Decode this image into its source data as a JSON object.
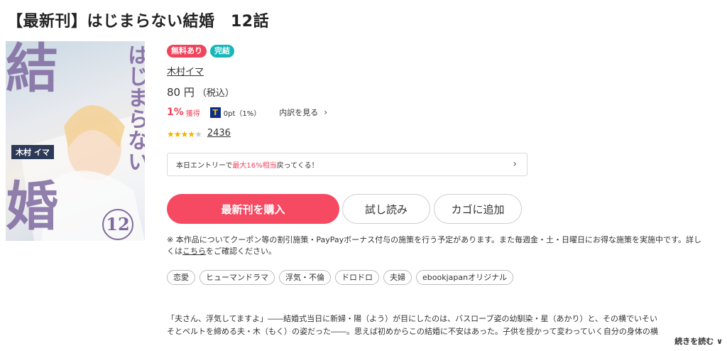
{
  "title": "【最新刊】はじまらない結婚　12話",
  "cover": {
    "big_top": "結",
    "big_bottom": "婚",
    "vertical": "はじまらない",
    "author_band": "木村 イマ",
    "volume": "12"
  },
  "badges": {
    "free": "無料あり",
    "complete": "完結"
  },
  "author": "木村イマ",
  "price": {
    "amount": "80 円",
    "tax": "（税込）"
  },
  "points": {
    "rate": "1%",
    "rate_label": "獲得",
    "t_icon": "T",
    "t_value": "0pt（1%）",
    "breakdown": "内訳を見る",
    "chevron": "›"
  },
  "rating": {
    "stars": 4,
    "count": "2436"
  },
  "entry": {
    "prefix": "本日エントリーで",
    "highlight": "最大16%相当",
    "suffix": "戻ってくる！",
    "arrow": "›"
  },
  "buttons": {
    "buy": "最新刊を購入",
    "trial": "試し読み",
    "cart": "カゴに追加"
  },
  "notice": {
    "line1": "※ 本作品についてクーポン等の割引施策・PayPayボーナス付与の施策を行う予定があります。また毎週金・土・日曜日にお得な施策を実施中です。詳し",
    "line2_prefix": "くは",
    "line2_link": "こちら",
    "line2_suffix": "をご確認ください。"
  },
  "tags": [
    "恋愛",
    "ヒューマンドラマ",
    "浮気・不倫",
    "ドロドロ",
    "夫婦",
    "ebookjapanオリジナル"
  ],
  "description": {
    "line1": "「夫さん、浮気してますよ」――結婚式当日に新婦・陽（よう）が目にしたのは、バスローブ姿の幼馴染・星（あかり）と、その横でいそい",
    "line2": "そとベルトを締める夫・木（もく）の姿だった――。思えば初めからこの結婚に不安はあった。子供を授かって変わっていく自分の身体の横"
  },
  "more": "続きを読む ∨",
  "colors": {
    "accent": "#f54a62",
    "teal": "#17b7b9",
    "star": "#f0b400"
  }
}
